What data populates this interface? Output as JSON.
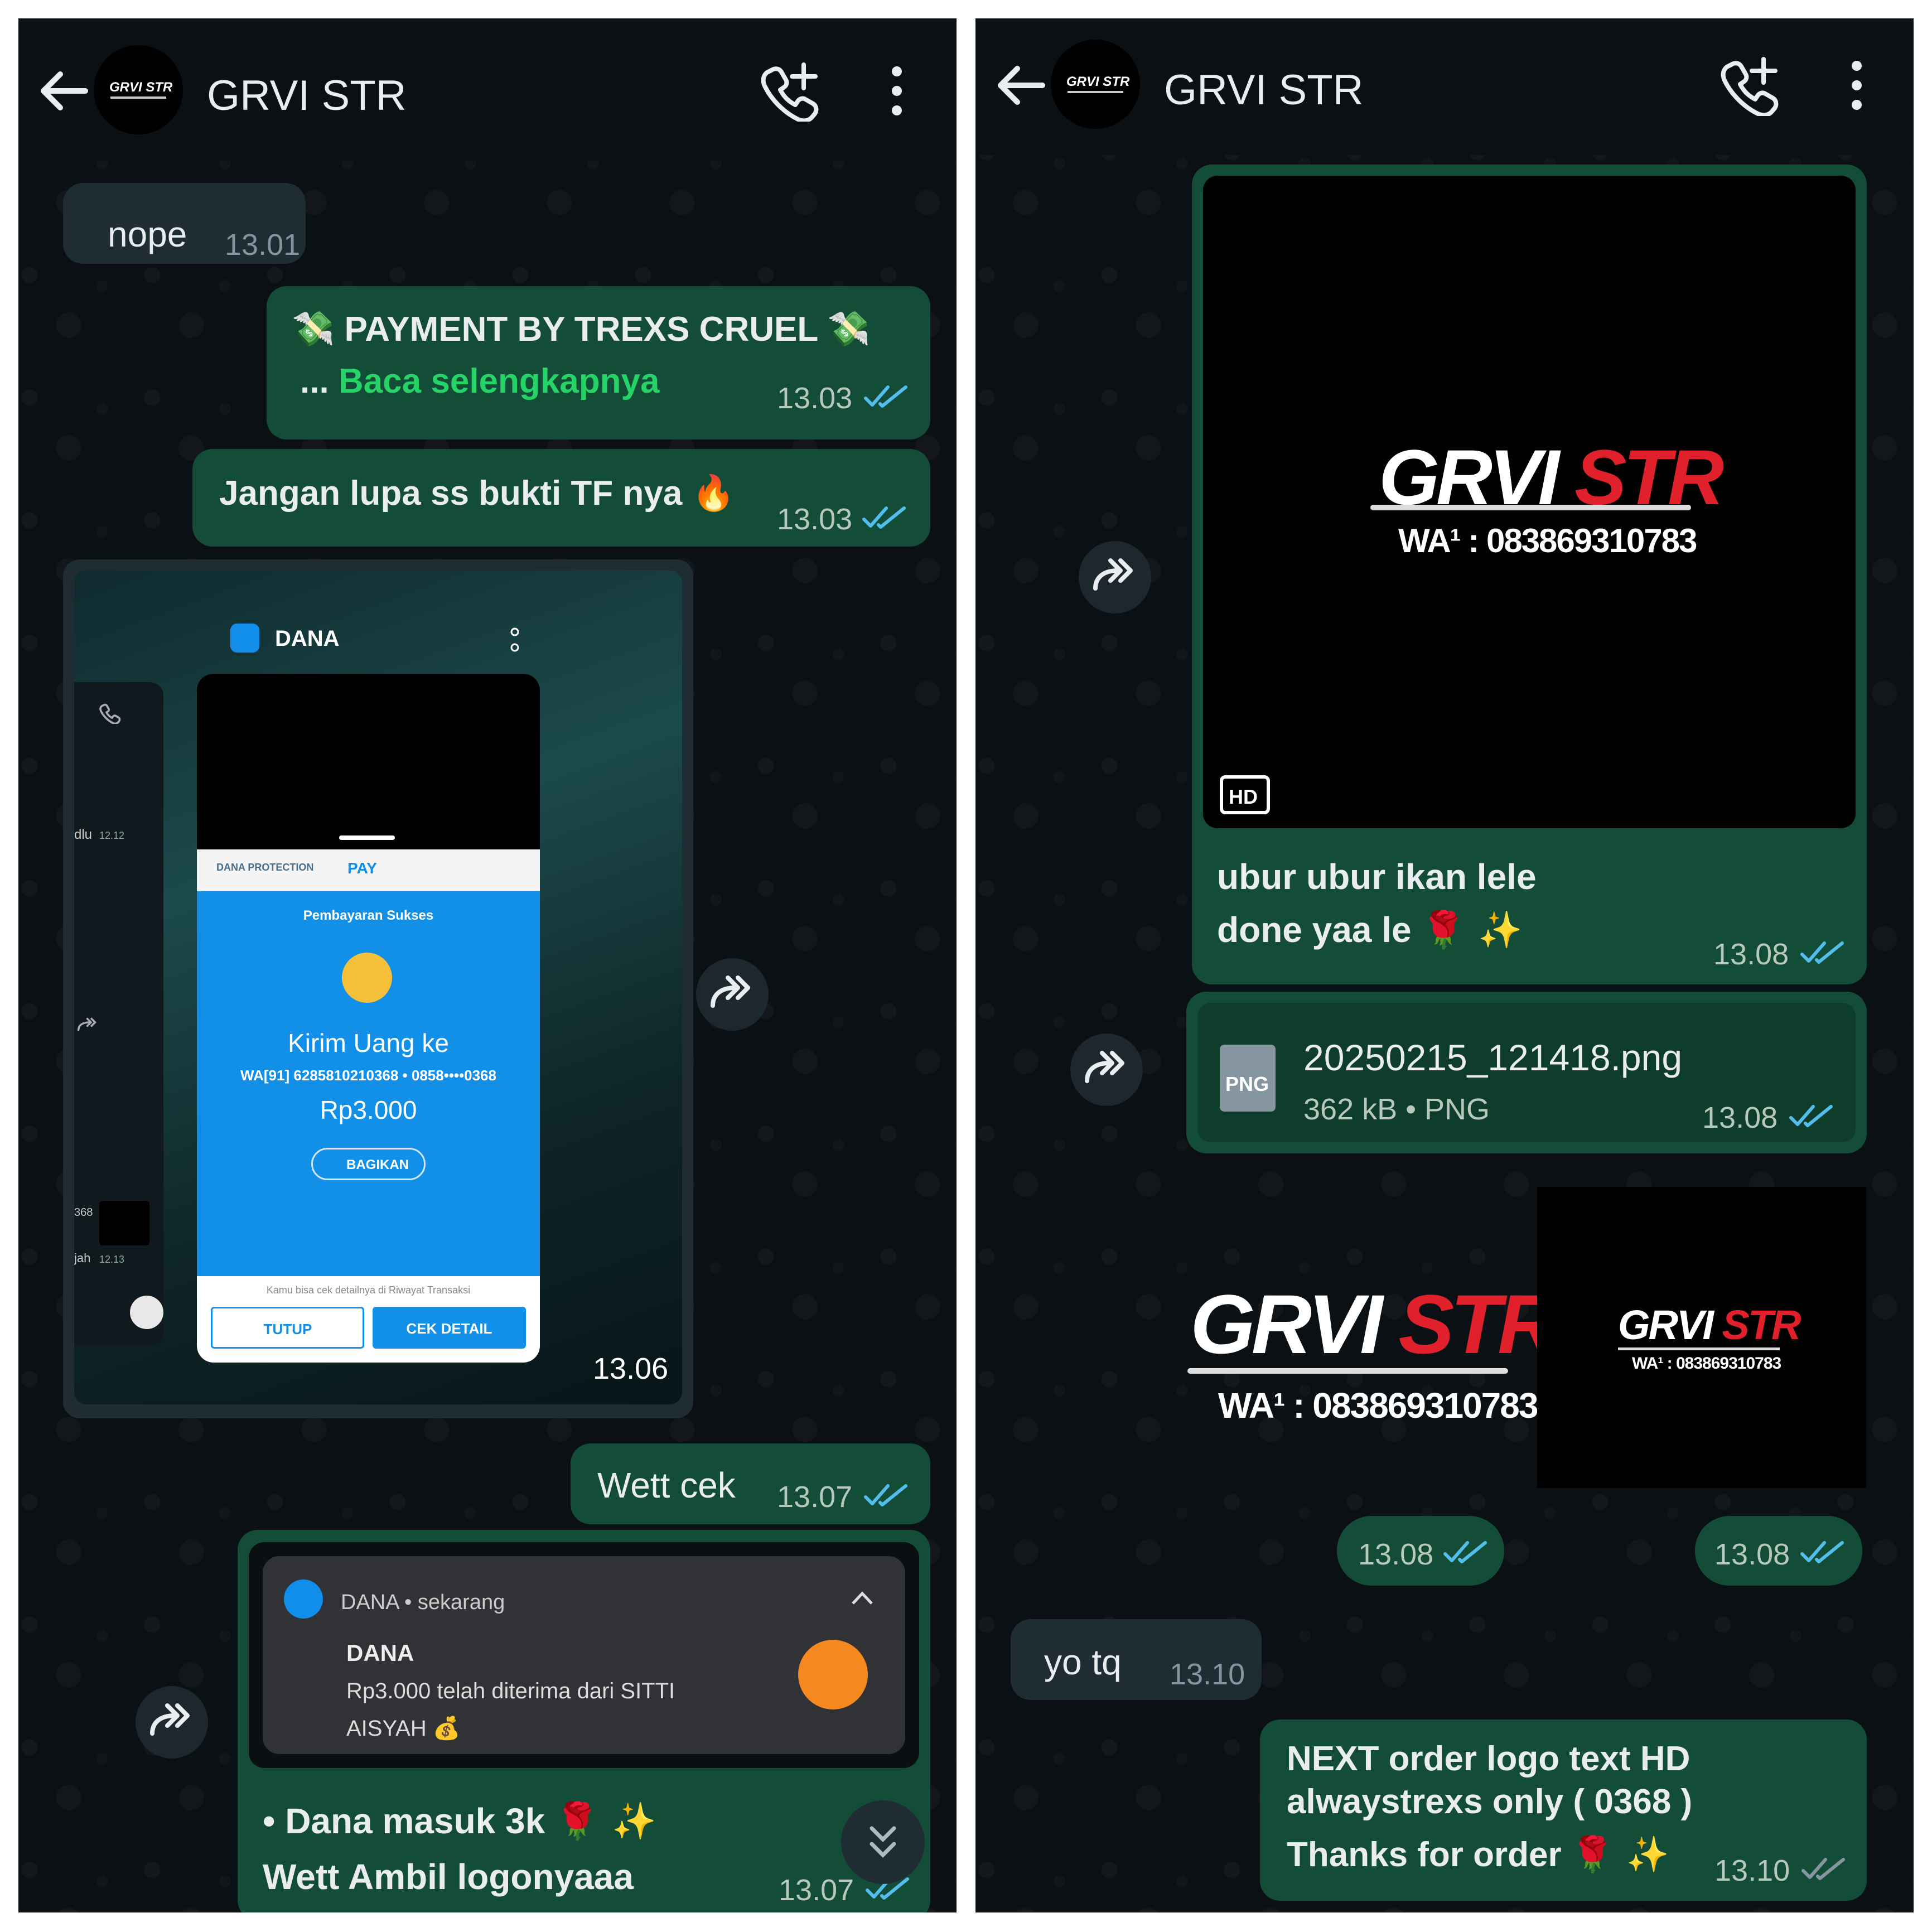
{
  "left": {
    "header": {
      "title": "GRVI STR",
      "avatar_text": "GRVI STR"
    },
    "messages": {
      "nope": {
        "text": "nope",
        "time": "13.01"
      },
      "payment": {
        "line1": "PAYMENT BY TREXS CRUEL",
        "ellipsis": "...",
        "read_more": "Baca selengkapnya",
        "time": "13.03",
        "emoji": "💸"
      },
      "jangan": {
        "text": "Jangan lupa ss bukti TF nya",
        "emoji": "🔥",
        "time": "13.03"
      },
      "screenshot": {
        "time": "13.06",
        "app_name": "DANA",
        "protection": "DANA PROTECTION",
        "pay": "PAY",
        "status": "Pembayaran Sukses",
        "kirim": "Kirim Uang ke",
        "recipient": "WA[91] 6285810210368 • 0858••••0368",
        "amount": "Rp3.000",
        "share": "BAGIKAN",
        "footer_note": "Kamu bisa cek detailnya di Riwayat Transaksi",
        "close": "TUTUP",
        "detail": "CEK DETAIL",
        "side_dlu": "dlu",
        "side_time1": "12.12",
        "side_368": "368",
        "side_jah": "jah",
        "side_time2": "12.13"
      },
      "wett": {
        "text": "Wett cek",
        "time": "13.07"
      },
      "notif_msg": {
        "notif_app": "DANA",
        "notif_when": "sekarang",
        "notif_title": "DANA",
        "notif_body1": "Rp3.000 telah diterima dari SITTI",
        "notif_body2": "AISYAH",
        "money_emoji": "💰",
        "caption1": "• Dana masuk 3k",
        "caption2": "Wett Ambil logonyaaa",
        "caption_emoji": "🌹 ✨",
        "time": "13.07"
      }
    }
  },
  "right": {
    "header": {
      "title": "GRVI STR"
    },
    "messages": {
      "image": {
        "logo_a": "GRVI",
        "logo_b": "STR",
        "wa": "WA¹ : 083869310783",
        "hd": "HD",
        "caption1": "ubur ubur ikan lele",
        "caption2": "done yaa le",
        "caption_emoji": "🌹 ✨",
        "time": "13.08"
      },
      "file": {
        "badge": "PNG",
        "name": "20250215_121418.png",
        "meta": "362 kB • PNG",
        "time": "13.08"
      },
      "sticker": {
        "logo_a": "GRVI",
        "logo_b": "STR",
        "wa": "WA¹ : 083869310783",
        "time": "13.08"
      },
      "thumb": {
        "logo_a": "GRVI",
        "logo_b": "STR",
        "wa": "WA¹ : 083869310783",
        "time": "13.08"
      },
      "yotq": {
        "text": "yo tq",
        "time": "13.10"
      },
      "next": {
        "line1": "NEXT order logo text HD",
        "line2": "alwaystrexs only ( 0368 )",
        "line3": "Thanks for order",
        "emoji": "🌹 ✨",
        "time": "13.10"
      }
    }
  },
  "colors": {
    "outgoing_bubble": "#134d37",
    "incoming_bubble": "#1f2c34",
    "link": "#25d366",
    "read_ticks": "#53bdeb",
    "background": "#0b1014"
  },
  "icons": [
    "back-arrow-icon",
    "add-call-icon",
    "more-vert-icon",
    "forward-icon",
    "double-check-icon",
    "chevron-double-down-icon"
  ]
}
